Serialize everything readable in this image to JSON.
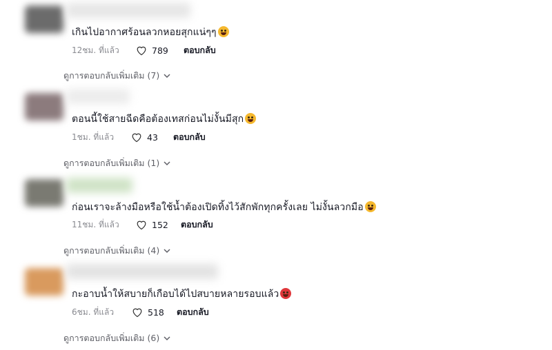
{
  "comments": [
    {
      "text": "เกินไปอากาศร้อนลวกหอยสุกแน่ๆๆ",
      "emoji_icon": "grinning-sweat-emoji",
      "emoji_color": "#f5b82e",
      "time": "12ชม. ที่แล้ว",
      "likes": "789",
      "reply_label": "ตอบกลับ",
      "more_label": "ดูการตอบกลับเพิ่มเติม (7)",
      "avatar_color": "#6b6b6b"
    },
    {
      "text": "ตอนนี้ใช้สายฉีดคือต้องเทสก่อนไม่งั้นมีสุก",
      "emoji_icon": "rolling-laughing-emoji",
      "emoji_color": "#f5b82e",
      "time": "1ชม. ที่แล้ว",
      "likes": "43",
      "reply_label": "ตอบกลับ",
      "more_label": "ดูการตอบกลับเพิ่มเติม (1)",
      "avatar_color": "#8c7b7d"
    },
    {
      "text": "ก่อนเราจะล้างมือหรือใช้น้ำต้องเปิดทิ้งไว้สักพักทุกครั้งเลย ไม่งั้นลวกมือ",
      "emoji_icon": "grinning-sweat-emoji",
      "emoji_color": "#f5b82e",
      "time": "11ชม. ที่แล้ว",
      "likes": "152",
      "reply_label": "ตอบกลับ",
      "more_label": "ดูการตอบกลับเพิ่มเติม (4)",
      "avatar_color": "#7a7a72"
    },
    {
      "text": "กะอาบน้ำให้สบายก็เกือบได้ไปสบายหลายรอบแล้ว",
      "emoji_icon": "angry-face-emoji",
      "emoji_color": "#e0373b",
      "time": "6ชม. ที่แล้ว",
      "likes": "518",
      "reply_label": "ตอบกลับ",
      "more_label": "ดูการตอบกลับเพิ่มเติม (6)",
      "avatar_color": "#d99a5e"
    }
  ]
}
